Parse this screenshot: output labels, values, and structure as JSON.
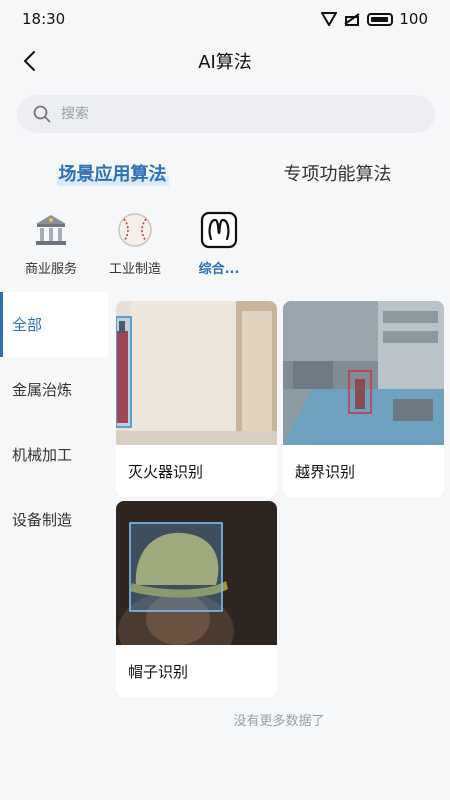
{
  "status_bar": {
    "time": "18:30",
    "battery": "100"
  },
  "nav": {
    "title": "AI算法"
  },
  "search": {
    "placeholder": "搜索"
  },
  "main_tabs": [
    {
      "label": "场景应用算法",
      "active": true
    },
    {
      "label": "专项功能算法",
      "active": false
    }
  ],
  "categories": [
    {
      "label": "商业服务",
      "icon": "bank-building-icon",
      "active": false
    },
    {
      "label": "工业制造",
      "icon": "baseball-icon",
      "active": false
    },
    {
      "label": "综合...",
      "icon": "omega-symbol-icon",
      "active": true
    }
  ],
  "sidebar": {
    "items": [
      {
        "label": "全部",
        "active": true
      },
      {
        "label": "金属治炼",
        "active": false
      },
      {
        "label": "机械加工",
        "active": false
      },
      {
        "label": "设备制造",
        "active": false
      }
    ]
  },
  "cards": [
    {
      "label": "灭火器识别",
      "image": "fire-extinguisher-photo"
    },
    {
      "label": "越界识别",
      "image": "factory-boundary-photo"
    },
    {
      "label": "帽子识别",
      "image": "hat-detection-photo"
    }
  ],
  "footer": {
    "no_more": "没有更多数据了"
  },
  "colors": {
    "accent": "#2d6fb8",
    "background": "#f6f7f9",
    "card": "#ffffff"
  }
}
